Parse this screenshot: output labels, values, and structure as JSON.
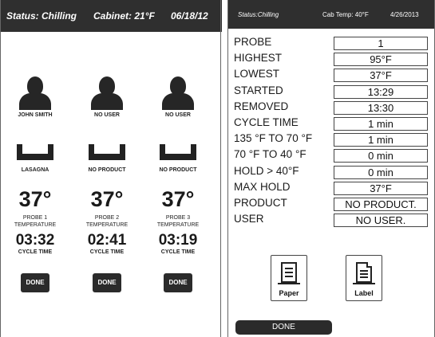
{
  "left_screen": {
    "header": {
      "status": "Status: Chilling",
      "cabinet": "Cabinet: 21°F",
      "date": "06/18/12"
    },
    "probes": [
      {
        "user": "JOHN SMITH",
        "product": "LASAGNA",
        "temperature": "37°",
        "probe_label": "PROBE 1 TEMPERATURE",
        "time": "03:32",
        "cycle_label": "CYCLE TIME",
        "done_label": "DONE"
      },
      {
        "user": "NO USER",
        "product": "NO PRODUCT",
        "temperature": "37°",
        "probe_label": "PROBE 2 TEMPERATURE",
        "time": "02:41",
        "cycle_label": "CYCLE TIME",
        "done_label": "DONE"
      },
      {
        "user": "NO USER",
        "product": "NO PRODUCT",
        "temperature": "37°",
        "probe_label": "PROBE 3 TEMPERATURE",
        "time": "03:19",
        "cycle_label": "CYCLE TIME",
        "done_label": "DONE"
      }
    ],
    "icons": {
      "user": "user-silhouette-icon",
      "product": "food-pan-icon"
    }
  },
  "right_screen": {
    "header": {
      "status": "Status:Chilling",
      "cab_temp": "Cab Temp:  40°F",
      "date": "4/26/2013"
    },
    "rows": [
      {
        "label": "PROBE",
        "value": "1"
      },
      {
        "label": "HIGHEST",
        "value": "95°F"
      },
      {
        "label": "LOWEST",
        "value": "37°F"
      },
      {
        "label": "STARTED",
        "value": "13:29"
      },
      {
        "label": "REMOVED",
        "value": "13:30"
      },
      {
        "label": "CYCLE TIME",
        "value": "1 min"
      },
      {
        "label": "135 °F TO 70 °F",
        "value": "1 min"
      },
      {
        "label": "70 °F TO 40 °F",
        "value": "0 min"
      },
      {
        "label": "HOLD > 40°F",
        "value": "0 min"
      },
      {
        "label": "MAX HOLD",
        "value": "37°F"
      },
      {
        "label": "PRODUCT",
        "value": "NO PRODUCT."
      },
      {
        "label": "USER",
        "value": "NO USER."
      }
    ],
    "buttons": {
      "paper": "Paper",
      "label": "Label",
      "done": "DONE"
    },
    "icons": {
      "paper": "paper-print-icon",
      "label": "label-print-icon"
    }
  },
  "colors": {
    "header_bg": "#2f2f2f",
    "button_bg": "#2b2b2b",
    "icon": "#262626"
  }
}
